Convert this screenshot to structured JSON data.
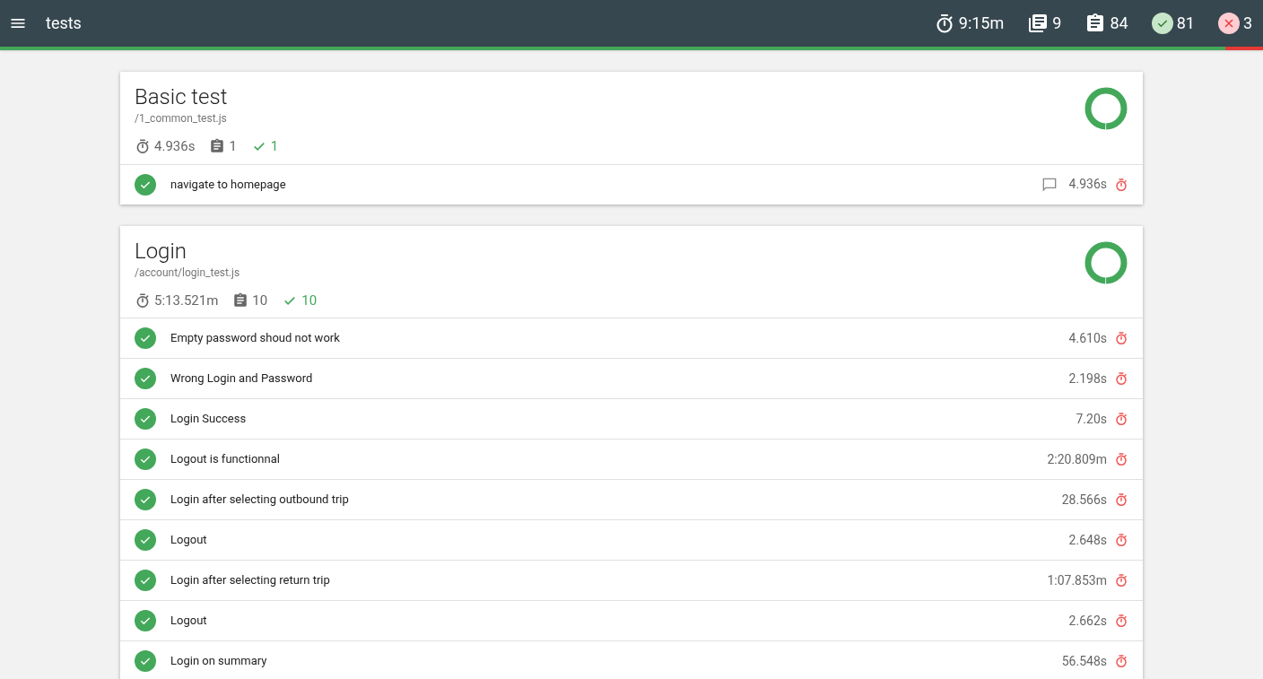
{
  "header": {
    "title": "tests",
    "duration": "9:15m",
    "suites": "9",
    "tests": "84",
    "passed": "81",
    "failed": "3",
    "progress": {
      "level": 0.97
    }
  },
  "suites": [
    {
      "title": "Basic test",
      "file": "/1_common_test.js",
      "duration": "4.936s",
      "tests": "1",
      "passed": "1",
      "tests_list": [
        {
          "name": "navigate to homepage",
          "duration": "4.936s",
          "kind": "passed",
          "has_comment": true
        }
      ]
    },
    {
      "title": "Login",
      "file": "/account/login_test.js",
      "duration": "5:13.521m",
      "tests": "10",
      "passed": "10",
      "tests_list": [
        {
          "name": "Empty password shoud not work",
          "duration": "4.610s",
          "kind": "passed",
          "has_comment": false
        },
        {
          "name": "Wrong Login and Password",
          "duration": "2.198s",
          "kind": "passed",
          "has_comment": false
        },
        {
          "name": "Login Success",
          "duration": "7.20s",
          "kind": "passed",
          "has_comment": false
        },
        {
          "name": "Logout is functionnal",
          "duration": "2:20.809m",
          "kind": "passed",
          "has_comment": false
        },
        {
          "name": "Login after selecting outbound trip",
          "duration": "28.566s",
          "kind": "passed",
          "has_comment": false
        },
        {
          "name": "Logout",
          "duration": "2.648s",
          "kind": "passed",
          "has_comment": false
        },
        {
          "name": "Login after selecting return trip",
          "duration": "1:07.853m",
          "kind": "passed",
          "has_comment": false
        },
        {
          "name": "Logout",
          "duration": "2.662s",
          "kind": "passed",
          "has_comment": false
        },
        {
          "name": "Login on summary",
          "duration": "56.548s",
          "kind": "passed",
          "has_comment": false
        }
      ]
    }
  ]
}
